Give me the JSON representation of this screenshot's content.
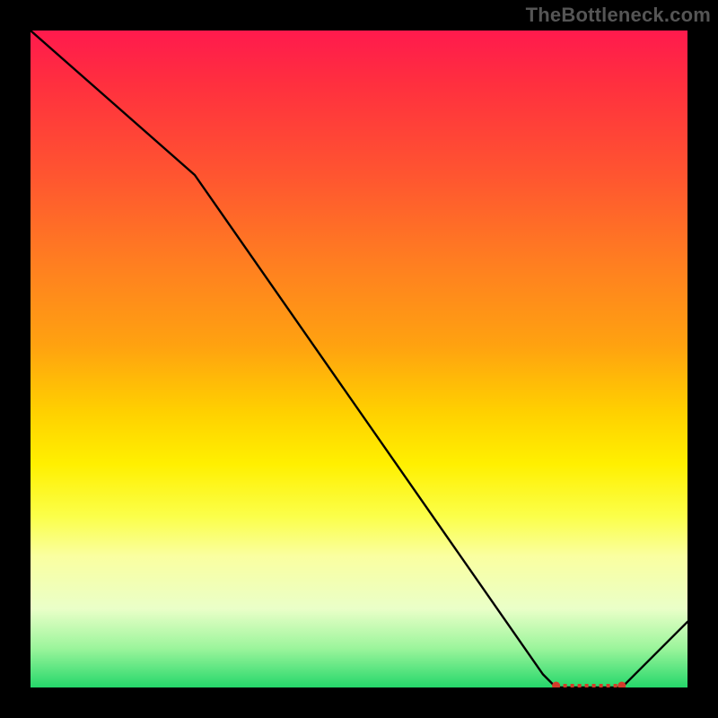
{
  "watermark": "TheBottleneck.com",
  "chart_data": {
    "type": "line",
    "title": "",
    "xlabel": "",
    "ylabel": "",
    "xlim": [
      0,
      100
    ],
    "ylim": [
      0,
      100
    ],
    "series": [
      {
        "name": "bottleneck-curve",
        "x": [
          0,
          25,
          78,
          80,
          90,
          100
        ],
        "values": [
          100,
          78,
          2,
          0,
          0,
          10
        ]
      }
    ],
    "annotations": [
      {
        "name": "optimal-range-marker",
        "x_start": 80,
        "x_end": 90,
        "y": 0
      }
    ]
  }
}
